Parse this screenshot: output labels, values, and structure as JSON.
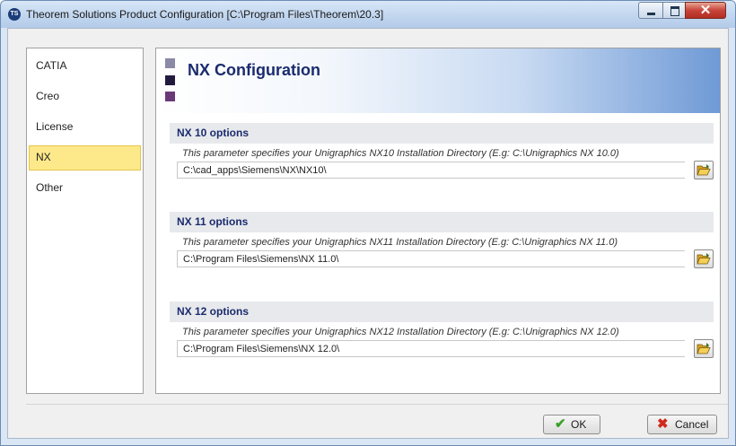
{
  "window": {
    "title": "Theorem Solutions Product Configuration [C:\\Program Files\\Theorem\\20.3]",
    "app_icon_text": "TS"
  },
  "sidebar": {
    "items": [
      {
        "label": "CATIA",
        "selected": false
      },
      {
        "label": "Creo",
        "selected": false
      },
      {
        "label": "License",
        "selected": false
      },
      {
        "label": "NX",
        "selected": true
      },
      {
        "label": "Other",
        "selected": false
      }
    ]
  },
  "panel": {
    "title": "NX Configuration",
    "sections": [
      {
        "heading": "NX 10 options",
        "description": "This parameter specifies your Unigraphics NX10 Installation Directory (E.g: C:\\Unigraphics NX 10.0)",
        "value": "C:\\cad_apps\\Siemens\\NX\\NX10\\"
      },
      {
        "heading": "NX 11 options",
        "description": "This parameter specifies your Unigraphics NX11 Installation Directory (E.g: C:\\Unigraphics NX 11.0)",
        "value": "C:\\Program Files\\Siemens\\NX 11.0\\"
      },
      {
        "heading": "NX 12 options",
        "description": "This parameter specifies your Unigraphics NX12 Installation Directory (E.g: C:\\Unigraphics NX 12.0)",
        "value": "C:\\Program Files\\Siemens\\NX 12.0\\"
      }
    ]
  },
  "buttons": {
    "ok_label": "OK",
    "cancel_label": "Cancel"
  },
  "colors": {
    "accent_title": "#1b2b6e",
    "selected_item": "#fde98a",
    "ok_icon": "#3ba02a",
    "cancel_icon": "#d02a1e"
  }
}
